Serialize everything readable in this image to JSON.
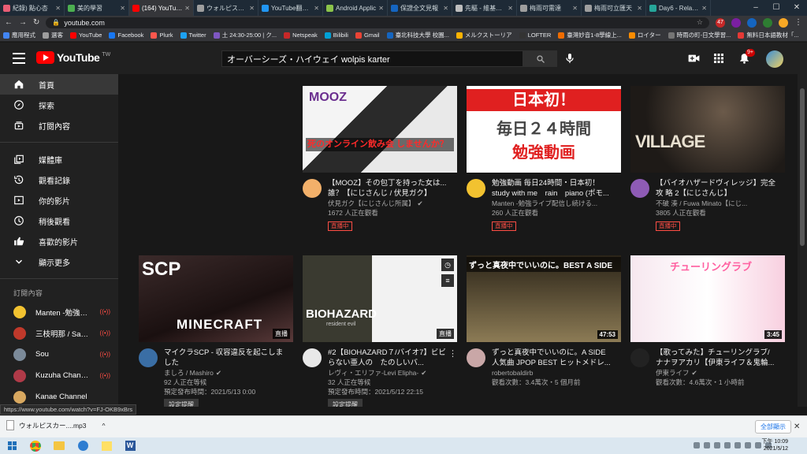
{
  "browser": {
    "tabs": [
      {
        "title": "紀錄) 點心杏",
        "color": "#e85d75"
      },
      {
        "title": "美的學習",
        "color": "#4caf50"
      },
      {
        "title": "(164) YouTube",
        "color": "#ff0000",
        "active": true
      },
      {
        "title": "ウォルピスカー",
        "color": "#9e9e9e"
      },
      {
        "title": "YouTube翻MP",
        "color": "#2196f3"
      },
      {
        "title": "Android Applic",
        "color": "#8bc34a"
      },
      {
        "title": "保證全文見報",
        "color": "#1565c0"
      },
      {
        "title": "先驅 - 維基百科",
        "color": "#bdbdbd"
      },
      {
        "title": "梅雨可需達",
        "color": "#9e9e9e"
      },
      {
        "title": "梅雨可立匯天",
        "color": "#9e9e9e"
      },
      {
        "title": "Day6 - Relative",
        "color": "#26a69a"
      }
    ],
    "url": "youtube.com",
    "bookmarks": [
      {
        "label": "應用程式",
        "color": "#4285f4"
      },
      {
        "label": "選客",
        "color": "#9e9e9e"
      },
      {
        "label": "YouTube",
        "color": "#ff0000"
      },
      {
        "label": "Facebook",
        "color": "#1877f2"
      },
      {
        "label": "Plurk",
        "color": "#ff574d"
      },
      {
        "label": "Twitter",
        "color": "#1da1f2"
      },
      {
        "label": "土 24:30-25:00 | ク...",
        "color": "#7e57c2"
      },
      {
        "label": "Netspeak",
        "color": "#c62828"
      },
      {
        "label": "Bilibili",
        "color": "#00a1d6"
      },
      {
        "label": "Gmail",
        "color": "#ea4335"
      },
      {
        "label": "臺北科技大學 校園...",
        "color": "#1565c0"
      },
      {
        "label": "メルクストーリア",
        "color": "#ffb300"
      },
      {
        "label": "LOFTER",
        "color": "#333333"
      },
      {
        "label": "臺灣妙音1-8學線上...",
        "color": "#ef6c00"
      },
      {
        "label": "ロイター",
        "color": "#fb8c00"
      },
      {
        "label": "時雨の町-日文學習...",
        "color": "#757575"
      },
      {
        "label": "無料日本語教材「...",
        "color": "#e53935"
      }
    ],
    "notif_badge_ext": "47"
  },
  "header": {
    "logo_text": "YouTube",
    "region": "TW",
    "search_value": "オーバーシーズ・ハイウェイ wolpis karter",
    "notification_count": "9+"
  },
  "sidebar": {
    "items": [
      {
        "label": "首頁",
        "icon": "home-icon",
        "active": true
      },
      {
        "label": "探索",
        "icon": "explore-icon"
      },
      {
        "label": "訂閱內容",
        "icon": "subscriptions-icon"
      }
    ],
    "items2": [
      {
        "label": "媒體庫",
        "icon": "library-icon"
      },
      {
        "label": "觀看記錄",
        "icon": "history-icon"
      },
      {
        "label": "你的影片",
        "icon": "your-videos-icon"
      },
      {
        "label": "稍後觀看",
        "icon": "watch-later-icon"
      },
      {
        "label": "喜歡的影片",
        "icon": "liked-icon"
      },
      {
        "label": "顯示更多",
        "icon": "chevron-down-icon"
      }
    ],
    "subs_heading": "訂閱內容",
    "channels": [
      {
        "name": "Manten -勉強ライ...",
        "color": "#f2c230",
        "live": true
      },
      {
        "name": "三枝明那 / Saegus...",
        "color": "#c0392b",
        "live": true
      },
      {
        "name": "Sou",
        "color": "#7b8a99",
        "live": true
      },
      {
        "name": "Kuzuha Channel",
        "color": "#b03a48",
        "live": true
      },
      {
        "name": "Kanae Channel",
        "color": "#d8a860",
        "live": false
      }
    ]
  },
  "videos": [
    {
      "title": "【MOOZ】その包丁を持った女は...誰？【にじさんじ / 伏見ガク】",
      "channel": "伏見ガク【にじさんじ所属】",
      "stat1": "1672 人正在觀看",
      "stat2": "",
      "badge": "直播中",
      "badge_type": "live",
      "thumb_top": "MOOZ",
      "thumb_sub": "死のオンライン飲み会 しませんか？",
      "duration": "",
      "avatar_color": "#f2b06a",
      "verified": true
    },
    {
      "title": "勉強動画 毎日24時間・日本初！study with me　rain　piano (ポモ...",
      "channel": "Manten -勉強ライブ配信し続ける...",
      "stat1": "260 人正在觀看",
      "stat2": "",
      "badge": "直播中",
      "badge_type": "live",
      "thumb_top": "日本初！",
      "thumb_sub": "毎日２４時間",
      "thumb_sub2": "勉強動画",
      "duration": "",
      "avatar_color": "#f2c230",
      "verified": false
    },
    {
      "title": "【バイオハザードヴィレッジ】完全 攻 略 2【にじさんじ】",
      "channel": "不破 湊 / Fuwa Minato【にじ...",
      "stat1": "3805 人正在觀看",
      "stat2": "",
      "badge": "直播中",
      "badge_type": "live",
      "thumb_top": "VILLAGE",
      "duration": "",
      "avatar_color": "#8e5bb5",
      "verified": false
    },
    {
      "title": "マイクラSCP - 収容違反を起こしました",
      "channel": "ましろ / Mashiro",
      "stat1": "92 人正在等候",
      "stat2": "預定發布時間：2021/5/13 0:00",
      "badge": "設定提醒",
      "badge_type": "remind",
      "thumb_top": "SCP",
      "thumb_sub": "MINECRAFT",
      "duration": "直播",
      "avatar_color": "#3a6ea5",
      "verified": true
    },
    {
      "title": "#2【BIOHAZARD７/バイオ7】ビビらない亜人の　たのしいバ...",
      "channel": "レヴィ・エリファ-Levi Elipha-",
      "stat1": "32 人正在等候",
      "stat2": "預定發布時間：2021/5/12 22:15",
      "badge": "設定提醒",
      "badge_type": "remind",
      "thumb_top": "BIOHAZARD",
      "thumb_sub": "resident evil",
      "duration": "直播",
      "avatar_color": "#e8e8e8",
      "verified": true
    },
    {
      "title": "ずっと真夜中でいいのに。A SIDE人気曲 JPOP BEST ヒットメドレ...",
      "channel": "robertobaldirb",
      "stat1": "觀看次數：3.4萬次・5 個月前",
      "stat2": "",
      "badge": "",
      "badge_type": "",
      "thumb_top": "ずっと真夜中でいいのに。BEST A SIDE",
      "duration": "47:53",
      "avatar_color": "#c9a7a7",
      "verified": false
    },
    {
      "title": "【歌ってみた】チューリングラブ/ナナヲアカリ【伊東ライフ＆鬼輪...",
      "channel": "伊東ライフ",
      "stat1": "觀看次數：4.6萬次・1 小時前",
      "stat2": "",
      "badge": "",
      "badge_type": "",
      "thumb_top": "チューリングラブ",
      "duration": "3:45",
      "avatar_color": "#222222",
      "verified": true
    }
  ],
  "status_url": "https://www.youtube.com/watch?v=FJ-OKB9xBrs",
  "download": {
    "file": "ウォルピスカー....mp3",
    "show_all": "全部顯示"
  },
  "clock": {
    "time": "下午 10:09",
    "date": "2021/5/12"
  }
}
